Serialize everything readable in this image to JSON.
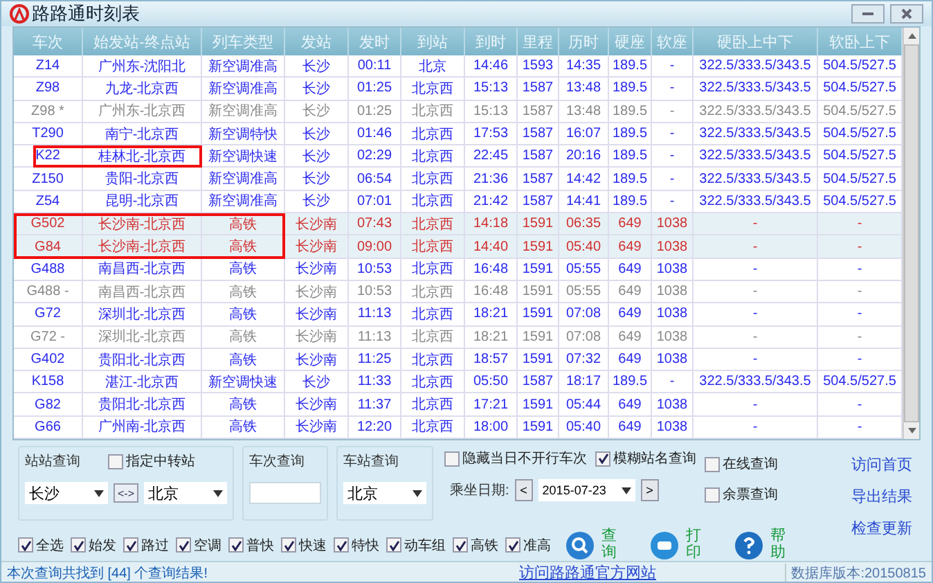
{
  "window": {
    "title": "路路通时刻表"
  },
  "table": {
    "columns": [
      "车次",
      "始发站-终点站",
      "列车类型",
      "发站",
      "发时",
      "到站",
      "到时",
      "里程",
      "历时",
      "硬座",
      "软座",
      "硬卧上中下",
      "软卧上下"
    ],
    "rows": [
      {
        "kind": "normal",
        "cells": [
          "Z14",
          "广州东-沈阳北",
          "新空调准高",
          "长沙",
          "00:11",
          "北京",
          "14:46",
          "1593",
          "14:35",
          "189.5",
          "-",
          "322.5/333.5/343.5",
          "504.5/527.5"
        ]
      },
      {
        "kind": "normal",
        "cells": [
          "Z98",
          "九龙-北京西",
          "新空调准高",
          "长沙",
          "01:25",
          "北京西",
          "15:13",
          "1587",
          "13:48",
          "189.5",
          "-",
          "322.5/333.5/343.5",
          "504.5/527.5"
        ]
      },
      {
        "kind": "inactive",
        "cells": [
          "Z98 *",
          "广州东-北京西",
          "新空调准高",
          "长沙",
          "01:25",
          "北京西",
          "15:13",
          "1587",
          "13:48",
          "189.5",
          "-",
          "322.5/333.5/343.5",
          "504.5/527.5"
        ]
      },
      {
        "kind": "normal",
        "cells": [
          "T290",
          "南宁-北京西",
          "新空调特快",
          "长沙",
          "01:46",
          "北京西",
          "17:53",
          "1587",
          "16:07",
          "189.5",
          "-",
          "322.5/333.5/343.5",
          "504.5/527.5"
        ]
      },
      {
        "kind": "normal",
        "outlined": true,
        "outline_wide": false,
        "cells": [
          "K22",
          "桂林北-北京西",
          "新空调快速",
          "长沙",
          "02:29",
          "北京西",
          "22:45",
          "1587",
          "20:16",
          "189.5",
          "-",
          "322.5/333.5/343.5",
          "504.5/527.5"
        ]
      },
      {
        "kind": "normal",
        "cells": [
          "Z150",
          "贵阳-北京西",
          "新空调准高",
          "长沙",
          "06:54",
          "北京西",
          "21:36",
          "1587",
          "14:42",
          "189.5",
          "-",
          "322.5/333.5/343.5",
          "504.5/527.5"
        ]
      },
      {
        "kind": "normal",
        "cells": [
          "Z54",
          "昆明-北京西",
          "新空调准高",
          "长沙",
          "07:01",
          "北京西",
          "21:42",
          "1587",
          "14:41",
          "189.5",
          "-",
          "322.5/333.5/343.5",
          "504.5/527.5"
        ]
      },
      {
        "kind": "highlight",
        "outlined": true,
        "outline_wide": true,
        "cells": [
          "G502",
          "长沙南-北京西",
          "高铁",
          "长沙南",
          "07:43",
          "北京西",
          "14:18",
          "1591",
          "06:35",
          "649",
          "1038",
          "-",
          "-"
        ]
      },
      {
        "kind": "highlight",
        "outlined": true,
        "outline_wide": true,
        "cells": [
          "G84",
          "长沙南-北京西",
          "高铁",
          "长沙南",
          "09:00",
          "北京西",
          "14:40",
          "1591",
          "05:40",
          "649",
          "1038",
          "-",
          "-"
        ]
      },
      {
        "kind": "normal",
        "cells": [
          "G488",
          "南昌西-北京西",
          "高铁",
          "长沙南",
          "10:53",
          "北京西",
          "16:48",
          "1591",
          "05:55",
          "649",
          "1038",
          "-",
          "-"
        ]
      },
      {
        "kind": "inactive",
        "cells": [
          "G488 -",
          "南昌西-北京西",
          "高铁",
          "长沙南",
          "10:53",
          "北京西",
          "16:48",
          "1591",
          "05:55",
          "649",
          "1038",
          "-",
          "-"
        ]
      },
      {
        "kind": "normal",
        "cells": [
          "G72",
          "深圳北-北京西",
          "高铁",
          "长沙南",
          "11:13",
          "北京西",
          "18:21",
          "1591",
          "07:08",
          "649",
          "1038",
          "-",
          "-"
        ]
      },
      {
        "kind": "inactive",
        "cells": [
          "G72 -",
          "深圳北-北京西",
          "高铁",
          "长沙南",
          "11:13",
          "北京西",
          "18:21",
          "1591",
          "07:08",
          "649",
          "1038",
          "-",
          "-"
        ]
      },
      {
        "kind": "normal",
        "cells": [
          "G402",
          "贵阳北-北京西",
          "高铁",
          "长沙南",
          "11:25",
          "北京西",
          "18:57",
          "1591",
          "07:32",
          "649",
          "1038",
          "-",
          "-"
        ]
      },
      {
        "kind": "normal",
        "cells": [
          "K158",
          "湛江-北京西",
          "新空调快速",
          "长沙",
          "11:33",
          "北京西",
          "05:50",
          "1587",
          "18:17",
          "189.5",
          "-",
          "322.5/333.5/343.5",
          "504.5/527.5"
        ]
      },
      {
        "kind": "normal",
        "cells": [
          "G82",
          "贵阳北-北京西",
          "高铁",
          "长沙南",
          "11:37",
          "北京西",
          "17:21",
          "1591",
          "05:44",
          "649",
          "1038",
          "-",
          "-"
        ]
      },
      {
        "kind": "normal",
        "cells": [
          "G66",
          "广州南-北京西",
          "高铁",
          "长沙南",
          "12:20",
          "北京西",
          "18:00",
          "1591",
          "05:40",
          "649",
          "1038",
          "-",
          "-"
        ]
      }
    ]
  },
  "station_query": {
    "title": "站站查询",
    "transfer": {
      "label": "指定中转站",
      "checked": false
    },
    "from": "长沙",
    "swap": "<->",
    "to": "北京"
  },
  "train_query": {
    "title": "车次查询"
  },
  "stop_query": {
    "title": "车站查询",
    "station": "北京"
  },
  "options": [
    {
      "label": "隐藏当日不开行车次",
      "checked": false
    },
    {
      "label": "模糊站名查询",
      "checked": true
    }
  ],
  "date": {
    "label": "乘坐日期:",
    "prev": "<",
    "value": "2015-07-23",
    "next": ">"
  },
  "online": [
    {
      "label": "在线查询",
      "checked": false
    },
    {
      "label": "余票查询",
      "checked": false
    }
  ],
  "links": [
    "访问首页",
    "导出结果",
    "检查更新"
  ],
  "filters": [
    {
      "label": "全选",
      "checked": true
    },
    {
      "label": "始发",
      "checked": true
    },
    {
      "label": "路过",
      "checked": true
    },
    {
      "label": "空调",
      "checked": true
    },
    {
      "label": "普快",
      "checked": true
    },
    {
      "label": "快速",
      "checked": true
    },
    {
      "label": "特快",
      "checked": true
    },
    {
      "label": "动车组",
      "checked": true
    },
    {
      "label": "高铁",
      "checked": true
    },
    {
      "label": "准高",
      "checked": true
    }
  ],
  "actions": [
    {
      "kind": "search",
      "label": "查询"
    },
    {
      "kind": "print",
      "label": "打印"
    },
    {
      "kind": "help",
      "label": "帮助"
    }
  ],
  "status_bar": {
    "result": "本次查询共找到 [44] 个查询结果!",
    "link": "访问路路通官方网站",
    "version": "数据库版本:20150815"
  }
}
